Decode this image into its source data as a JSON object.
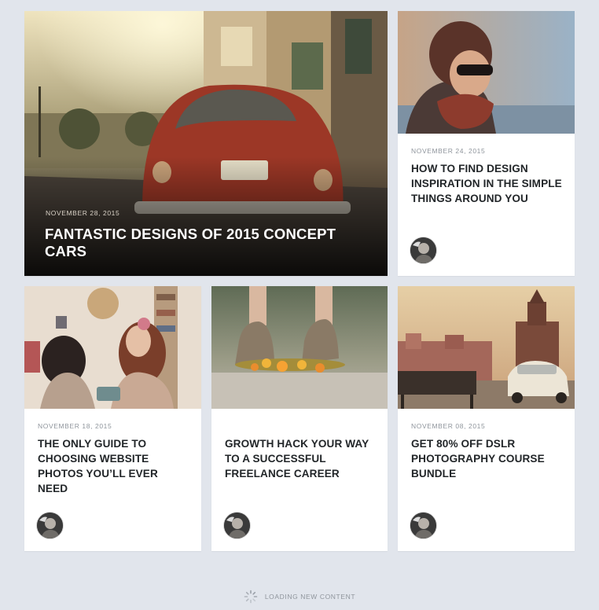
{
  "featured": {
    "date": "NOVEMBER 28, 2015",
    "title": "FANTASTIC DESIGNS OF 2015 CONCEPT CARS"
  },
  "posts": [
    {
      "date": "NOVEMBER 24, 2015",
      "title": "HOW TO FIND DESIGN INSPIRATION IN THE SIMPLE THINGS AROUND YOU"
    },
    {
      "date": "NOVEMBER 18, 2015",
      "title": "THE ONLY GUIDE TO CHOOSING WEBSITE PHOTOS YOU’LL EVER NEED"
    },
    {
      "date": "",
      "title": "GROWTH HACK YOUR WAY TO A SUCCESSFUL FREELANCE CAREER"
    },
    {
      "date": "NOVEMBER 08, 2015",
      "title": "GET 80% OFF DSLR PHOTOGRAPHY COURSE BUNDLE"
    }
  ],
  "loading": {
    "label": "LOADING NEW CONTENT"
  },
  "colors": {
    "background": "#e1e5ec",
    "card": "#ffffff",
    "title": "#222629",
    "meta": "#8f959c"
  },
  "icons": [
    "spinner-icon",
    "author-avatar"
  ]
}
